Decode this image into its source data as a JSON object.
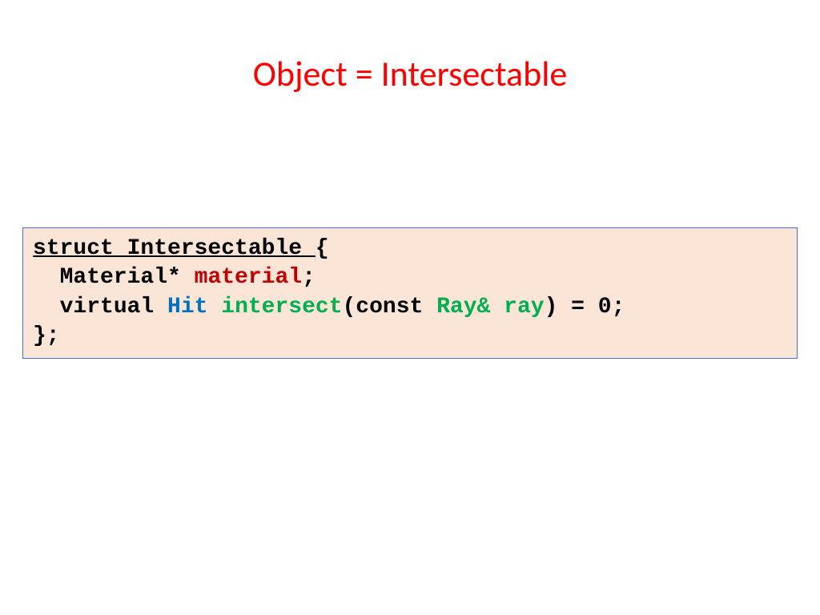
{
  "title": "Object = Intersectable",
  "code": {
    "line1_struct": "struct Intersectable ",
    "line1_brace": "{",
    "line2_prefix": "  Material* ",
    "line2_material": "material",
    "line2_suffix": ";",
    "line3_virtual": "  virtual ",
    "line3_hit": "Hit",
    "line3_space1": " ",
    "line3_intersect": "intersect",
    "line3_open": "(const ",
    "line3_ray_type": "Ray&",
    "line3_space2": " ",
    "line3_ray_var": "ray",
    "line3_close": ") = 0;",
    "line4": "};"
  }
}
